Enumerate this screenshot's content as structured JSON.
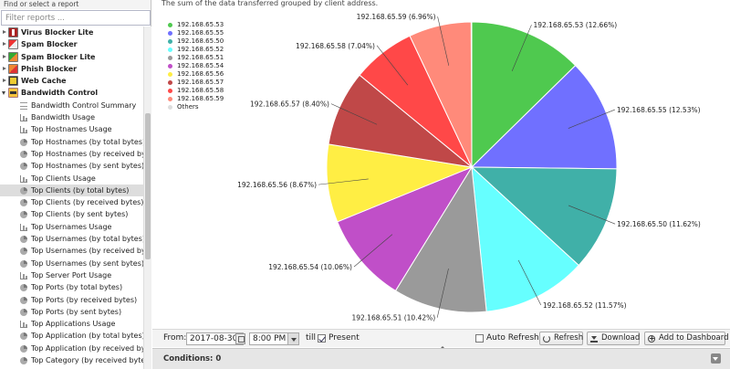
{
  "sidebar": {
    "title": "Find or select a report",
    "search_placeholder": "Filter reports ...",
    "items": [
      {
        "type": "app",
        "label": "Virus Blocker Lite",
        "icon": "virus-blocker-icon",
        "cls": "vb"
      },
      {
        "type": "app",
        "label": "Spam Blocker",
        "icon": "spam-blocker-icon",
        "cls": "sb"
      },
      {
        "type": "app",
        "label": "Spam Blocker Lite",
        "icon": "spam-blocker-lite-icon",
        "cls": "ws"
      },
      {
        "type": "app",
        "label": "Phish Blocker",
        "icon": "phish-blocker-icon",
        "cls": "pb"
      },
      {
        "type": "app",
        "label": "Web Cache",
        "icon": "web-cache-icon",
        "cls": "wc"
      },
      {
        "type": "app",
        "label": "Bandwidth Control",
        "icon": "bandwidth-control-icon",
        "cls": "bc",
        "open": true
      },
      {
        "type": "report",
        "label": "Bandwidth Control Summary",
        "icon": "text-report-icon",
        "cls": "txt"
      },
      {
        "type": "report",
        "label": "Bandwidth Usage",
        "icon": "bar-chart-icon",
        "cls": "bar"
      },
      {
        "type": "report",
        "label": "Top Hostnames Usage",
        "icon": "bar-chart-icon",
        "cls": "bar"
      },
      {
        "type": "report",
        "label": "Top Hostnames (by total bytes)",
        "icon": "pie-chart-icon",
        "cls": "pie"
      },
      {
        "type": "report",
        "label": "Top Hostnames (by received bytes)",
        "icon": "pie-chart-icon",
        "cls": "pie"
      },
      {
        "type": "report",
        "label": "Top Hostnames (by sent bytes)",
        "icon": "pie-chart-icon",
        "cls": "pie"
      },
      {
        "type": "report",
        "label": "Top Clients Usage",
        "icon": "bar-chart-icon",
        "cls": "bar"
      },
      {
        "type": "report",
        "label": "Top Clients (by total bytes)",
        "icon": "pie-chart-icon",
        "cls": "pie",
        "selected": true
      },
      {
        "type": "report",
        "label": "Top Clients (by received bytes)",
        "icon": "pie-chart-icon",
        "cls": "pie"
      },
      {
        "type": "report",
        "label": "Top Clients (by sent bytes)",
        "icon": "pie-chart-icon",
        "cls": "pie"
      },
      {
        "type": "report",
        "label": "Top Usernames Usage",
        "icon": "bar-chart-icon",
        "cls": "bar"
      },
      {
        "type": "report",
        "label": "Top Usernames (by total bytes)",
        "icon": "pie-chart-icon",
        "cls": "pie"
      },
      {
        "type": "report",
        "label": "Top Usernames (by received bytes)",
        "icon": "pie-chart-icon",
        "cls": "pie"
      },
      {
        "type": "report",
        "label": "Top Usernames (by sent bytes)",
        "icon": "pie-chart-icon",
        "cls": "pie"
      },
      {
        "type": "report",
        "label": "Top Server Port Usage",
        "icon": "bar-chart-icon",
        "cls": "bar"
      },
      {
        "type": "report",
        "label": "Top Ports (by total bytes)",
        "icon": "pie-chart-icon",
        "cls": "pie"
      },
      {
        "type": "report",
        "label": "Top Ports (by received bytes)",
        "icon": "pie-chart-icon",
        "cls": "pie"
      },
      {
        "type": "report",
        "label": "Top Ports (by sent bytes)",
        "icon": "pie-chart-icon",
        "cls": "pie"
      },
      {
        "type": "report",
        "label": "Top Applications Usage",
        "icon": "bar-chart-icon",
        "cls": "bar"
      },
      {
        "type": "report",
        "label": "Top Application (by total bytes)",
        "icon": "pie-chart-icon",
        "cls": "pie"
      },
      {
        "type": "report",
        "label": "Top Application (by received bytes)",
        "icon": "pie-chart-icon",
        "cls": "pie"
      },
      {
        "type": "report",
        "label": "Top Category (by received bytes)",
        "icon": "pie-chart-icon",
        "cls": "pie"
      }
    ]
  },
  "main": {
    "description": "The sum of the data transferred grouped by client address."
  },
  "chart_data": {
    "type": "pie",
    "legend_position": "top-left",
    "slices": [
      {
        "label": "192.168.65.53",
        "value": 12.66,
        "color": "#4fc94f"
      },
      {
        "label": "192.168.65.55",
        "value": 12.53,
        "color": "#7070ff"
      },
      {
        "label": "192.168.65.50",
        "value": 11.62,
        "color": "#40b0a8"
      },
      {
        "label": "192.168.65.52",
        "value": 11.57,
        "color": "#66ffff"
      },
      {
        "label": "192.168.65.51",
        "value": 10.42,
        "color": "#9a9a9a"
      },
      {
        "label": "192.168.65.54",
        "value": 10.06,
        "color": "#c04fc8"
      },
      {
        "label": "192.168.65.56",
        "value": 8.67,
        "color": "#ffee44"
      },
      {
        "label": "192.168.65.57",
        "value": 8.4,
        "color": "#c04848"
      },
      {
        "label": "192.168.65.58",
        "value": 7.04,
        "color": "#ff4848"
      },
      {
        "label": "192.168.65.59",
        "value": 6.96,
        "color": "#ff8a7a"
      }
    ],
    "legend": [
      {
        "label": "192.168.65.53",
        "color": "#4fc94f"
      },
      {
        "label": "192.168.65.55",
        "color": "#7070ff"
      },
      {
        "label": "192.168.65.50",
        "color": "#40b0a8"
      },
      {
        "label": "192.168.65.52",
        "color": "#66ffff"
      },
      {
        "label": "192.168.65.51",
        "color": "#9a9a9a"
      },
      {
        "label": "192.168.65.54",
        "color": "#c04fc8"
      },
      {
        "label": "192.168.65.56",
        "color": "#ffee44"
      },
      {
        "label": "192.168.65.57",
        "color": "#c04848"
      },
      {
        "label": "192.168.65.58",
        "color": "#ff4848"
      },
      {
        "label": "192.168.65.59",
        "color": "#ff8a7a"
      },
      {
        "label": "Others",
        "color": "#dddddd"
      }
    ]
  },
  "toolbar": {
    "from_label": "From:",
    "date_value": "2017-08-30",
    "time_value": "8:00 PM",
    "till_label": "till",
    "present_label": "Present",
    "present_checked": true,
    "auto_refresh_label": "Auto Refresh",
    "auto_refresh_checked": false,
    "refresh_label": "Refresh",
    "download_label": "Download",
    "dashboard_label": "Add to Dashboard"
  },
  "conditions": {
    "label": "Conditions: 0"
  }
}
